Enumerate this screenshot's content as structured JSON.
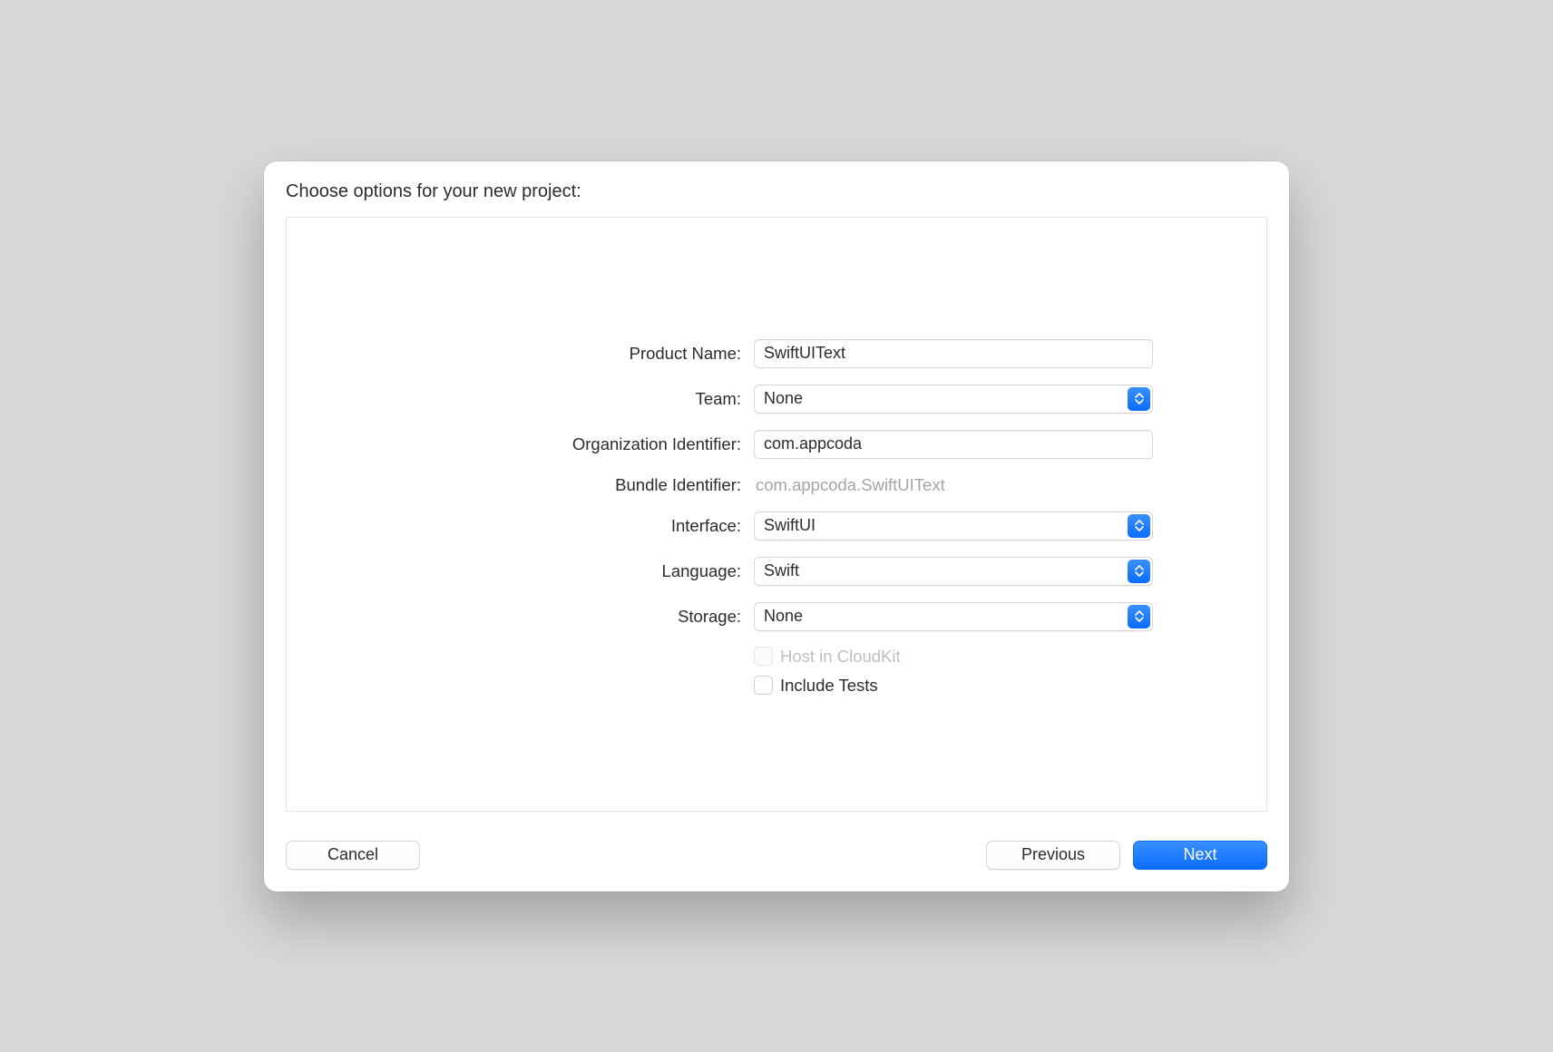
{
  "dialog": {
    "title": "Choose options for your new project:"
  },
  "form": {
    "product_name": {
      "label": "Product Name:",
      "value": "SwiftUIText"
    },
    "team": {
      "label": "Team:",
      "value": "None"
    },
    "org_identifier": {
      "label": "Organization Identifier:",
      "value": "com.appcoda"
    },
    "bundle_identifier": {
      "label": "Bundle Identifier:",
      "value": "com.appcoda.SwiftUIText"
    },
    "interface": {
      "label": "Interface:",
      "value": "SwiftUI"
    },
    "language": {
      "label": "Language:",
      "value": "Swift"
    },
    "storage": {
      "label": "Storage:",
      "value": "None"
    },
    "host_cloudkit": {
      "label": "Host in CloudKit",
      "checked": false,
      "enabled": false
    },
    "include_tests": {
      "label": "Include Tests",
      "checked": false,
      "enabled": true
    }
  },
  "footer": {
    "cancel": "Cancel",
    "previous": "Previous",
    "next": "Next"
  }
}
